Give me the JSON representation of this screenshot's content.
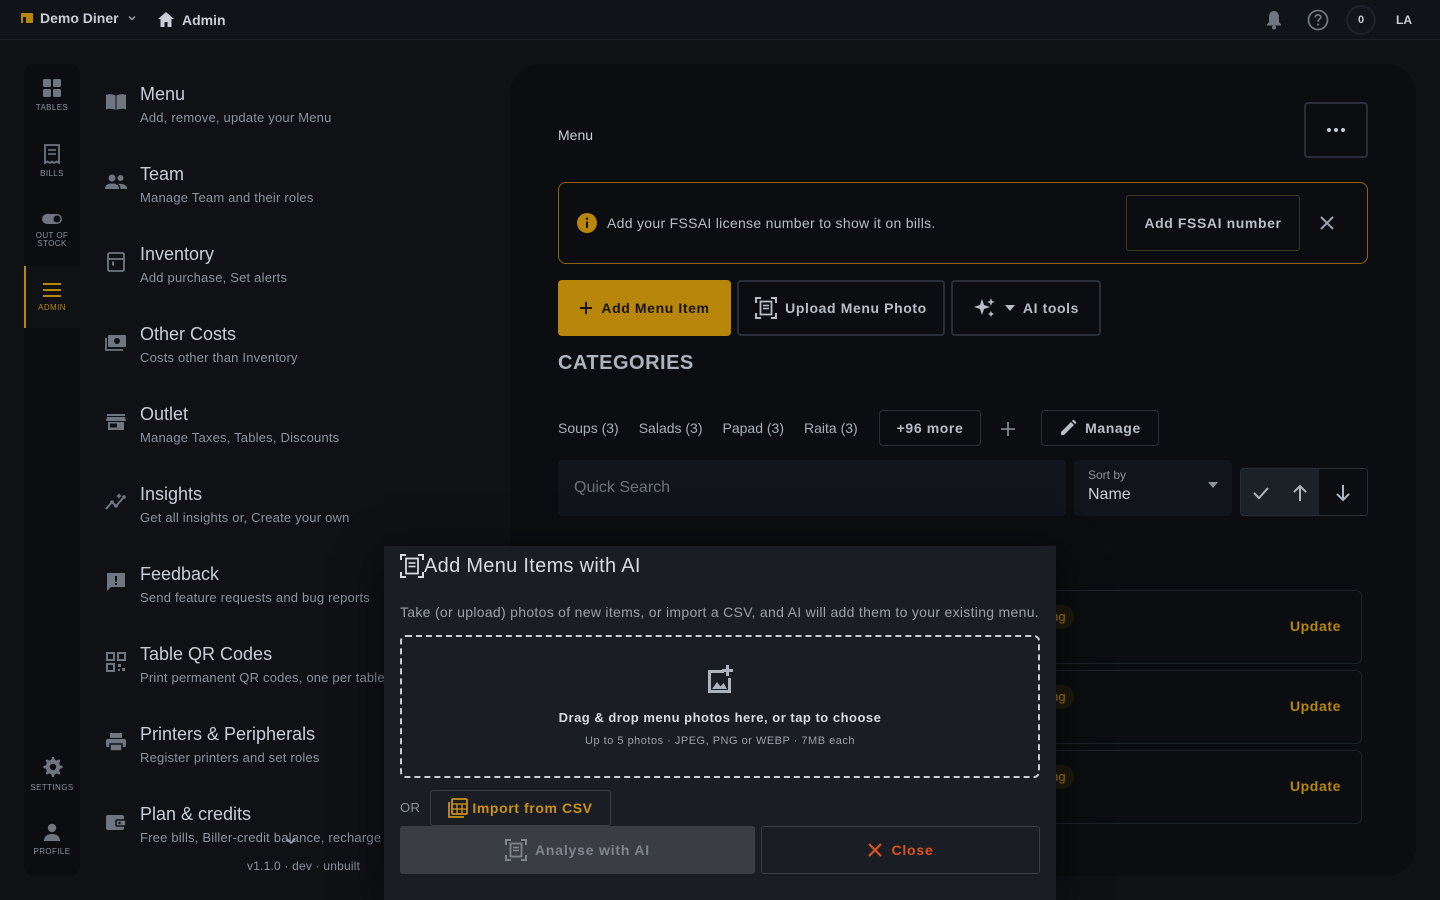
{
  "colors": {
    "accent": "#b8860b",
    "danger": "#d9531e",
    "background": "#0f1115",
    "surface": "#0b0d10",
    "modal": "#1a1d23"
  },
  "topbar": {
    "outlet_name": "Demo Diner",
    "breadcrumb": "Admin",
    "notification_count": "0",
    "avatar_initials": "LA"
  },
  "rail": {
    "items": [
      {
        "label": "TABLES",
        "icon": "grid-icon"
      },
      {
        "label": "BILLS",
        "icon": "receipt-icon"
      },
      {
        "label": "OUT OF STOCK",
        "icon": "toggle-icon"
      },
      {
        "label": "ADMIN",
        "icon": "hamburger-icon",
        "active": true
      },
      {
        "label": "SETTINGS",
        "icon": "gear-icon"
      },
      {
        "label": "PROFILE",
        "icon": "person-icon"
      }
    ]
  },
  "admin_menu": {
    "items": [
      {
        "title": "Menu",
        "subtitle": "Add, remove, update your Menu"
      },
      {
        "title": "Team",
        "subtitle": "Manage Team and their roles"
      },
      {
        "title": "Inventory",
        "subtitle": "Add purchase, Set alerts"
      },
      {
        "title": "Other Costs",
        "subtitle": "Costs other than Inventory"
      },
      {
        "title": "Outlet",
        "subtitle": "Manage Taxes, Tables, Discounts"
      },
      {
        "title": "Insights",
        "subtitle": "Get all insights or, Create your own"
      },
      {
        "title": "Feedback",
        "subtitle": "Send feature requests and bug reports"
      },
      {
        "title": "Table QR Codes",
        "subtitle": "Print permanent QR codes, one per table"
      },
      {
        "title": "Printers & Peripherals",
        "subtitle": "Register printers and set roles"
      },
      {
        "title": "Plan & credits",
        "subtitle": "Free bills, Biller-credit balance, recharge"
      }
    ],
    "version": "v1.1.0 · dev · unbuilt"
  },
  "main": {
    "title": "Menu",
    "alert": {
      "text": "Add your FSSAI license number to show it on bills.",
      "button": "Add FSSAI number"
    },
    "actions": {
      "add_item": "Add Menu Item",
      "upload_photo": "Upload Menu Photo",
      "ai_tools": "AI tools"
    },
    "categories_heading": "CATEGORIES",
    "categories": [
      "Soups (3)",
      "Salads (3)",
      "Papad (3)",
      "Raita (3)"
    ],
    "more_categories": "+96 more",
    "manage": "Manage",
    "search_placeholder": "Quick Search",
    "sort": {
      "label": "Sort by",
      "value": "Name"
    },
    "rows": [
      {
        "status": "ding",
        "action": "Update"
      },
      {
        "status": "ding",
        "action": "Update"
      },
      {
        "status": "ding",
        "action": "Update"
      }
    ]
  },
  "modal": {
    "title": "Add Menu Items with AI",
    "description": "Take (or upload) photos of new items, or import a CSV, and AI will add them to your existing menu.",
    "dropzone_main": "Drag & drop menu photos here, or tap to choose",
    "dropzone_sub": "Up to 5 photos · JPEG, PNG or WEBP · 7MB each",
    "or_label": "OR",
    "import_csv": "Import from CSV",
    "analyse": "Analyse with AI",
    "close": "Close"
  }
}
